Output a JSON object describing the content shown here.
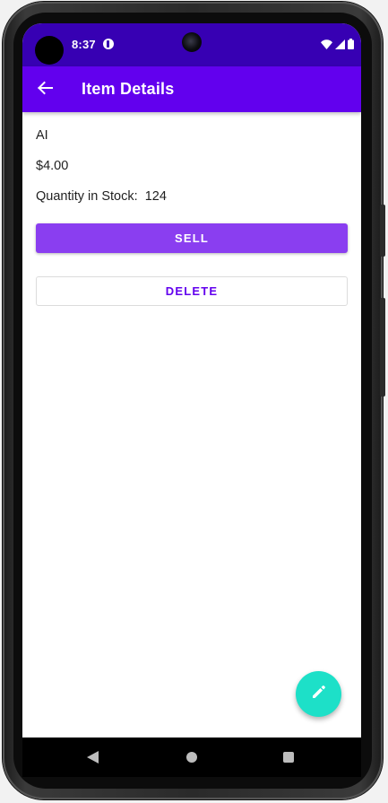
{
  "status_bar": {
    "time": "8:37",
    "notification_icon": "app-notification-icon",
    "wifi_icon": "wifi-icon",
    "signal_icon": "cell-signal-icon",
    "battery_icon": "battery-icon",
    "color": "#3700b3"
  },
  "app_bar": {
    "title": "Item Details",
    "back_icon": "arrow-back-icon",
    "color": "#6200ee"
  },
  "item": {
    "name": "AI",
    "price": "$4.00",
    "stock_label": "Quantity in Stock:  124"
  },
  "actions": {
    "sell_label": "SELL",
    "delete_label": "DELETE",
    "sell_color": "#8a3ef0",
    "delete_text_color": "#6200ee"
  },
  "fab": {
    "icon": "edit-pencil-icon",
    "color": "#1de0c8"
  },
  "nav_bar": {
    "back_icon": "nav-back-icon",
    "home_icon": "nav-home-icon",
    "recents_icon": "nav-recents-icon"
  }
}
